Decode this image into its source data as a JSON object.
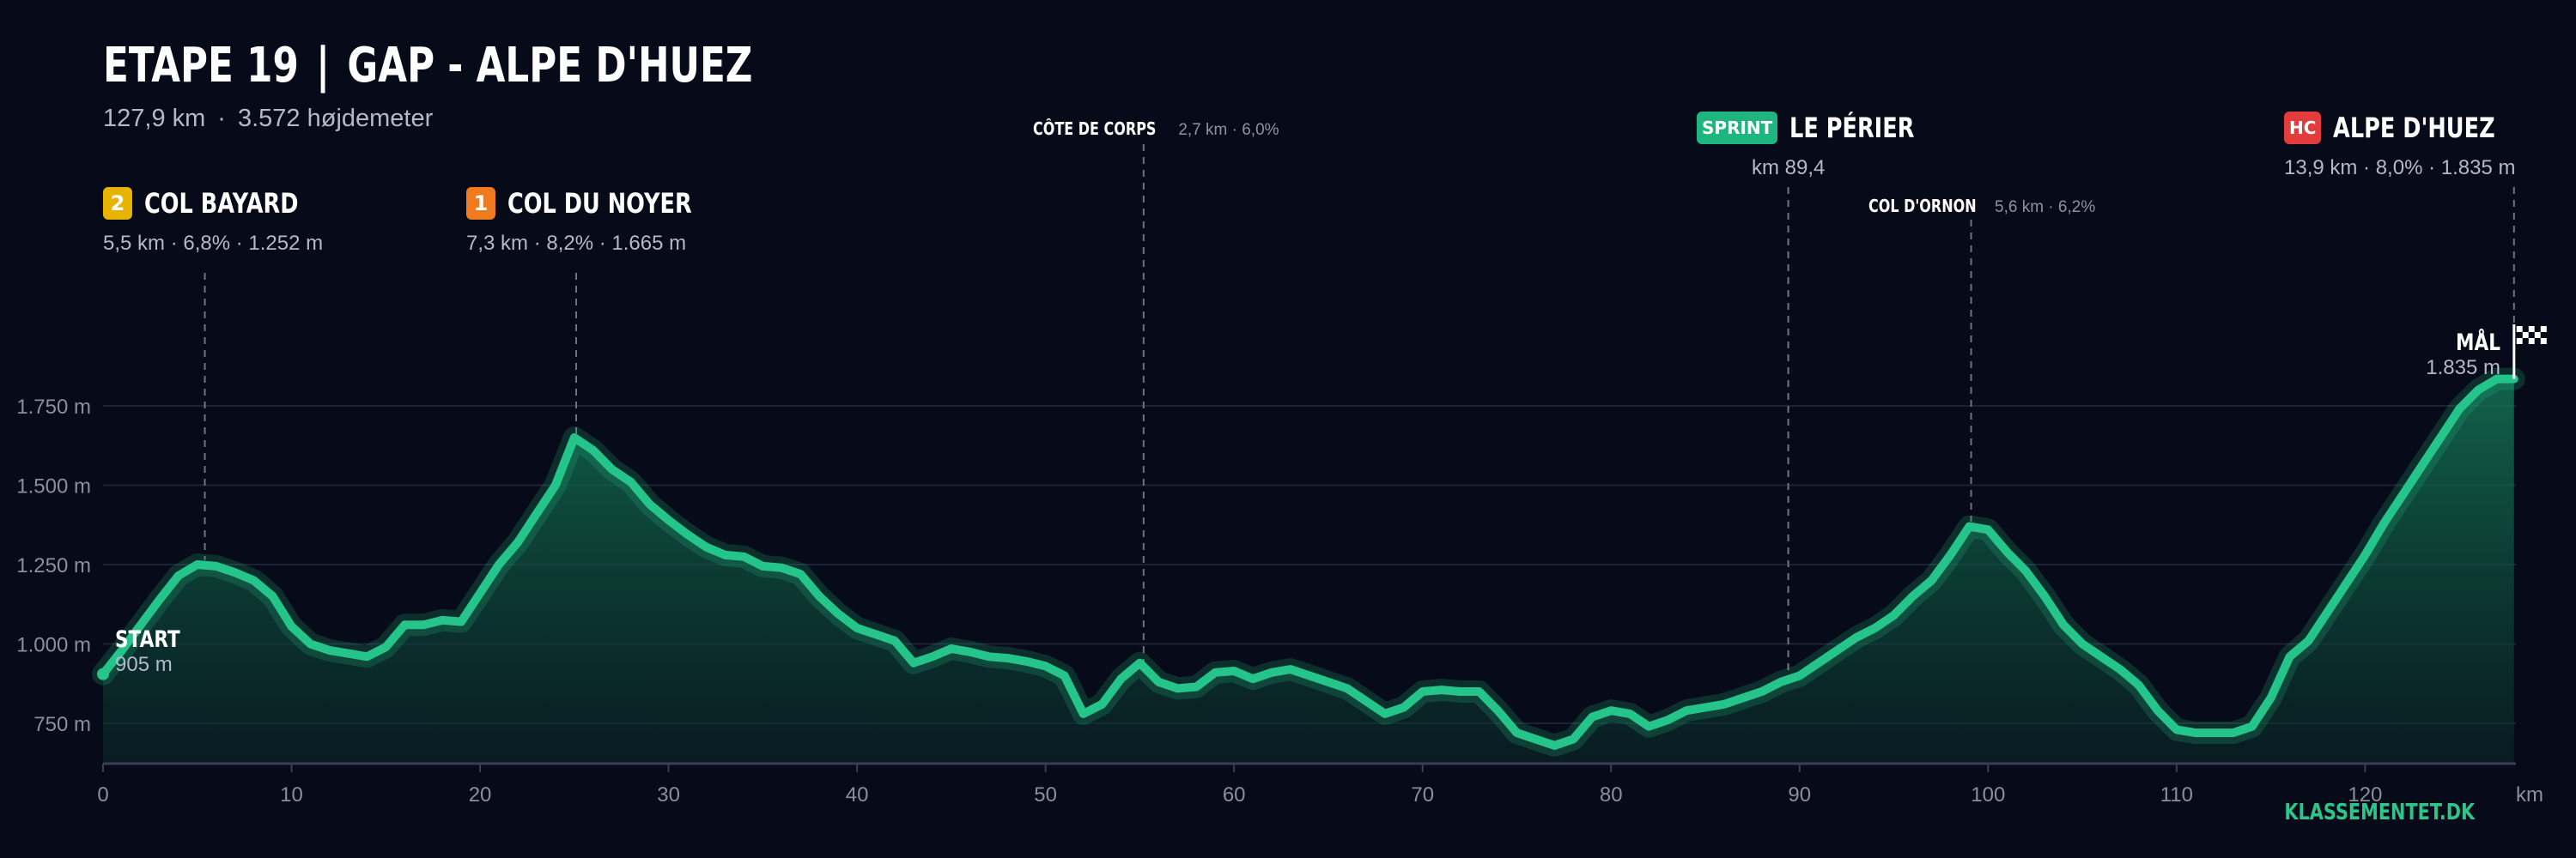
{
  "header": {
    "stage": "ETAPE 19",
    "separator": "|",
    "route": "GAP - ALPE D'HUEZ",
    "distance": "127,9 km",
    "dot": "·",
    "elevation_gain": "3.572 højdemeter"
  },
  "climbs": [
    {
      "id": "col-bayard",
      "badge": "2",
      "badge_color": "#e6b400",
      "name": "COL BAYARD",
      "info": "5,5 km · 6,8% · 1.252 m",
      "km": 5.4
    },
    {
      "id": "col-du-noyer",
      "badge": "1",
      "badge_color": "#f07a1e",
      "name": "COL DU NOYER",
      "info": "7,3 km · 8,2% · 1.665 m",
      "km": 25.1
    },
    {
      "id": "le-perier",
      "badge": "SPRINT",
      "badge_color": "#1fb57e",
      "name": "LE PÉRIER",
      "info": "km 89,4",
      "km": 89.4
    },
    {
      "id": "alpe-dhuez",
      "badge": "HC",
      "badge_color": "#e23c3c",
      "name": "ALPE D'HUEZ",
      "info": "13,9 km · 8,0% · 1.835 m",
      "km": 127.9
    }
  ],
  "small_climbs": [
    {
      "id": "cote-de-corps",
      "name": "CÔTE DE CORPS",
      "info": "2,7 km · 6,0%",
      "km": 55.2
    },
    {
      "id": "col-dornon",
      "name": "COL D'ORNON",
      "info": "5,6 km · 6,2%",
      "km": 99.1
    }
  ],
  "start": {
    "label": "START",
    "elevation": "905 m"
  },
  "finish": {
    "label": "MÅL",
    "elevation": "1.835 m"
  },
  "brand": "KLASSEMENTET.DK",
  "colors": {
    "background": "#070a18",
    "profile": "#1fb57e",
    "grid": "#1c2236",
    "axis": "#8a8fa0"
  },
  "chart_data": {
    "type": "area",
    "title": "ETAPE 19 | GAP - ALPE D'HUEZ",
    "subtitle": "127,9 km · 3.572 højdemeter",
    "xlabel": "km",
    "ylabel": "",
    "xlim": [
      0,
      128
    ],
    "ylim": [
      620,
      2100
    ],
    "x_ticks": [
      0,
      10,
      20,
      30,
      40,
      50,
      60,
      70,
      80,
      90,
      100,
      110,
      120
    ],
    "y_ticks": [
      750,
      1000,
      1250,
      1500,
      1750
    ],
    "y_tick_labels": [
      "750 m",
      "1.000 m",
      "1.250 m",
      "1.500 m",
      "1.750 m"
    ],
    "grid": true,
    "series": [
      {
        "x": [
          0,
          1,
          2,
          3,
          4,
          5,
          6,
          7,
          8,
          9,
          10,
          11,
          12,
          13,
          14,
          15,
          16,
          17,
          18,
          19,
          20,
          21,
          22,
          23,
          24,
          25,
          26,
          27,
          28,
          29,
          30,
          31,
          32,
          33,
          34,
          35,
          36,
          37,
          38,
          39,
          40,
          41,
          42,
          43,
          44,
          45,
          46,
          47,
          48,
          49,
          50,
          51,
          52,
          53,
          54,
          55,
          56,
          57,
          58,
          59,
          60,
          61,
          62,
          63,
          64,
          65,
          66,
          67,
          68,
          69,
          70,
          71,
          72,
          73,
          74,
          75,
          76,
          77,
          78,
          79,
          80,
          81,
          82,
          83,
          84,
          85,
          86,
          87,
          88,
          89,
          90,
          91,
          92,
          93,
          94,
          95,
          96,
          97,
          98,
          99,
          100,
          101,
          102,
          103,
          104,
          105,
          106,
          107,
          108,
          109,
          110,
          111,
          112,
          113,
          114,
          115,
          116,
          117,
          118,
          119,
          120,
          121,
          122,
          123,
          124,
          125,
          126,
          127,
          127.9
        ],
        "y": [
          905,
          980,
          1060,
          1140,
          1215,
          1250,
          1245,
          1225,
          1200,
          1150,
          1055,
          1000,
          980,
          970,
          960,
          990,
          1060,
          1060,
          1075,
          1070,
          1160,
          1250,
          1320,
          1410,
          1500,
          1650,
          1610,
          1550,
          1510,
          1440,
          1390,
          1345,
          1305,
          1280,
          1275,
          1245,
          1240,
          1220,
          1150,
          1095,
          1050,
          1030,
          1010,
          940,
          960,
          985,
          975,
          960,
          955,
          945,
          930,
          900,
          780,
          810,
          890,
          940,
          880,
          860,
          865,
          910,
          915,
          890,
          910,
          920,
          900,
          880,
          860,
          820,
          780,
          800,
          850,
          855,
          850,
          850,
          790,
          720,
          700,
          680,
          700,
          770,
          790,
          780,
          740,
          760,
          790,
          800,
          810,
          830,
          850,
          880,
          900,
          940,
          980,
          1020,
          1050,
          1090,
          1150,
          1200,
          1280,
          1370,
          1360,
          1290,
          1230,
          1150,
          1060,
          1000,
          960,
          920,
          870,
          790,
          730,
          720,
          720,
          720,
          740,
          830,
          960,
          1010,
          1100,
          1190,
          1280,
          1380,
          1470,
          1560,
          1650,
          1740,
          1800,
          1835,
          1835
        ]
      }
    ]
  }
}
